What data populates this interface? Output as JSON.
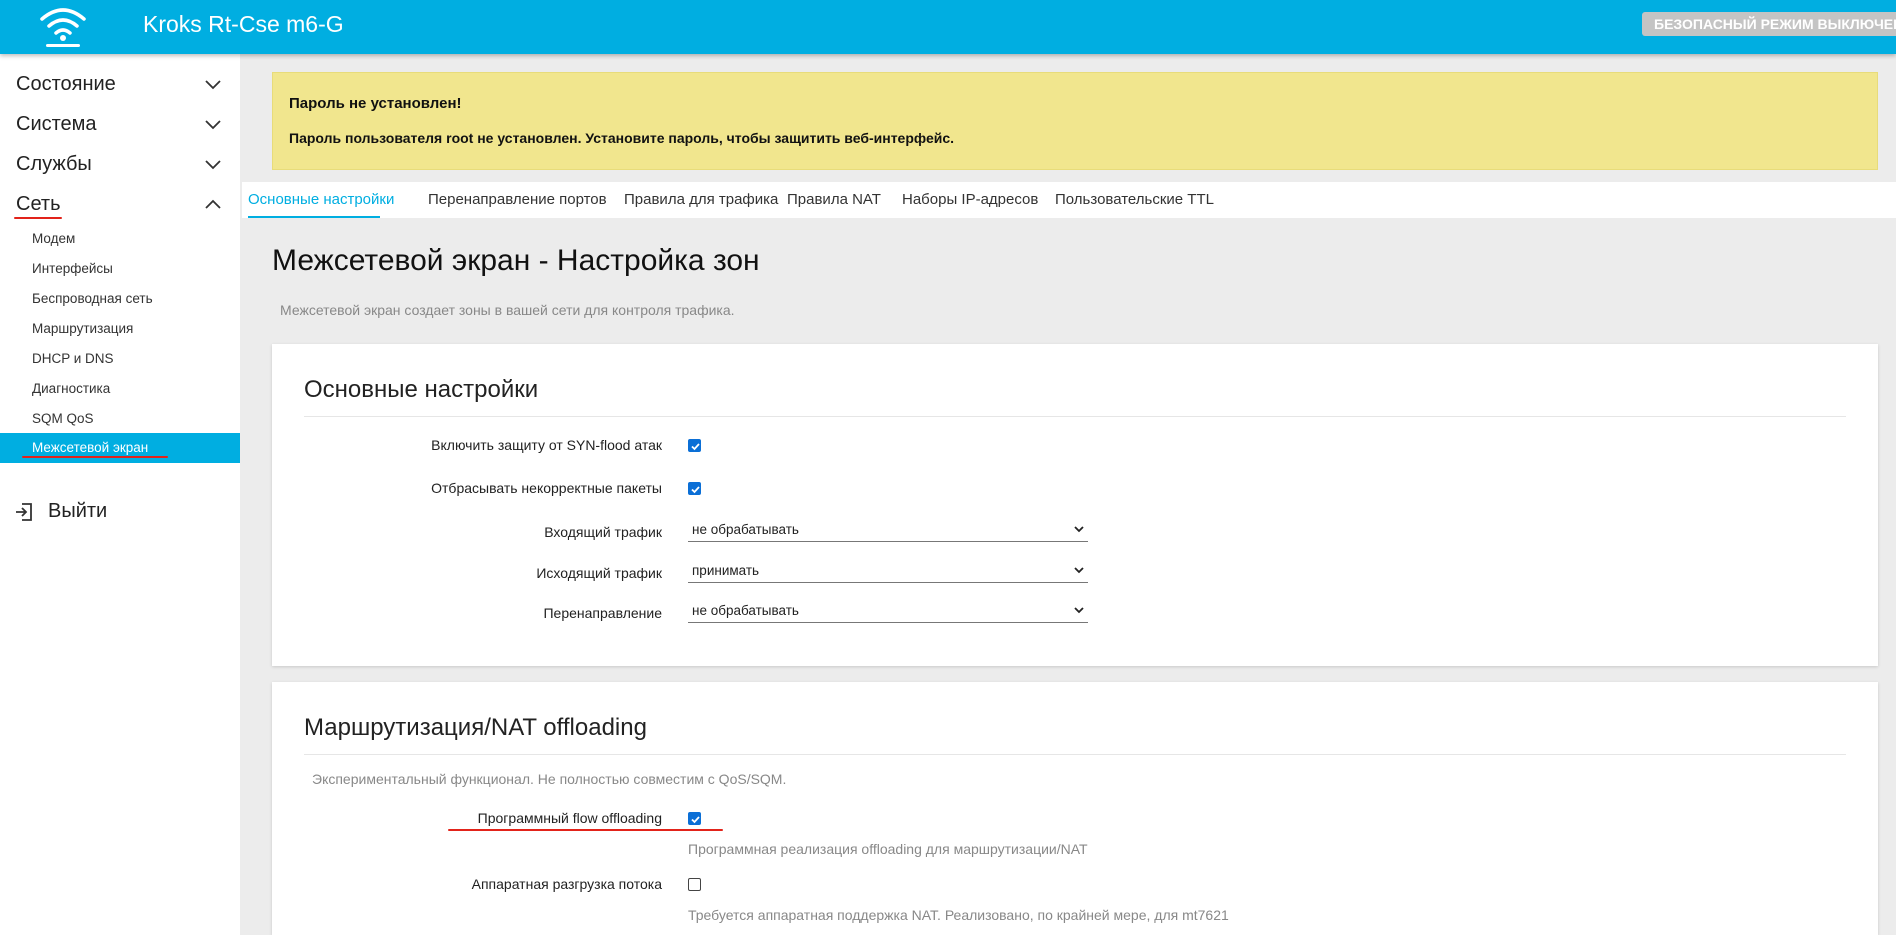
{
  "header": {
    "brand": "Kroks Rt-Cse m6-G",
    "safe_mode_label": "БЕЗОПАСНЫЙ РЕЖИМ ВЫКЛЮЧЕН",
    "logo_icon": "wifi-logo-icon",
    "bar_color": "#00aee1"
  },
  "sidebar": {
    "top_items": [
      {
        "label": "Состояние",
        "expanded": false
      },
      {
        "label": "Система",
        "expanded": false
      },
      {
        "label": "Службы",
        "expanded": false
      },
      {
        "label": "Сеть",
        "expanded": true
      }
    ],
    "sub_items": [
      {
        "label": "Модем"
      },
      {
        "label": "Интерфейсы"
      },
      {
        "label": "Беспроводная сеть"
      },
      {
        "label": "Маршрутизация"
      },
      {
        "label": "DHCP и DNS"
      },
      {
        "label": "Диагностика"
      },
      {
        "label": "SQM QoS"
      },
      {
        "label": "Межсетевой экран",
        "active": true
      }
    ],
    "logout_label": "Выйти"
  },
  "alert": {
    "title": "Пароль не установлен!",
    "message": "Пароль пользователя root не установлен. Установите пароль, чтобы защитить веб-интерфейс."
  },
  "tabs": [
    {
      "label": "Основные настройки",
      "active": true
    },
    {
      "label": "Перенаправление портов"
    },
    {
      "label": "Правила для трафика"
    },
    {
      "label": "Правила NAT"
    },
    {
      "label": "Наборы IP-адресов"
    },
    {
      "label": "Пользовательские TTL"
    }
  ],
  "page": {
    "title": "Межсетевой экран - Настройка зон",
    "description": "Межсетевой экран создает зоны в вашей сети для контроля трафика."
  },
  "general": {
    "title": "Основные настройки",
    "syn_flood_label": "Включить защиту от SYN-flood атак",
    "syn_flood_checked": true,
    "drop_invalid_label": "Отбрасывать некорректные пакеты",
    "drop_invalid_checked": true,
    "input_label": "Входящий трафик",
    "input_value": "не обрабатывать",
    "output_label": "Исходящий трафик",
    "output_value": "принимать",
    "forward_label": "Перенаправление",
    "forward_value": "не обрабатывать"
  },
  "offloading": {
    "title": "Маршрутизация/NAT offloading",
    "note": "Экспериментальный функционал. Не полностью совместим с QoS/SQM.",
    "sw_label": "Программный flow offloading",
    "sw_checked": true,
    "sw_hint": "Программная реализация offloading для маршрутизации/NAT",
    "hw_label": "Аппаратная разгрузка потока",
    "hw_checked": false,
    "hw_hint": "Требуется аппаратная поддержка NAT. Реализовано, по крайней мере, для mt7621"
  },
  "annotation_color": "#e2231a"
}
